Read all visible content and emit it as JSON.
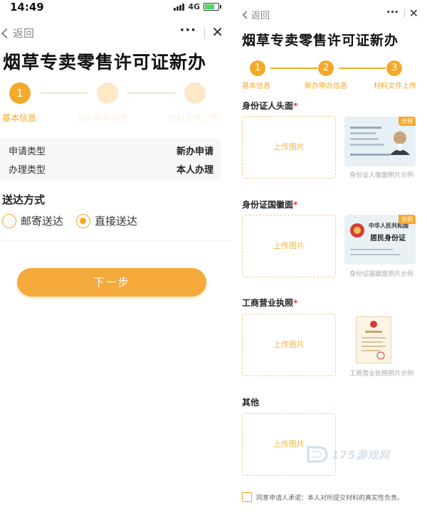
{
  "status": {
    "time": "14:49",
    "network": "4G"
  },
  "left": {
    "nav": {
      "back_label": "返回",
      "more": "···",
      "close": "✕"
    },
    "title": "烟草专卖零售许可证新办",
    "steps": [
      {
        "number": "1",
        "label": "基本信息",
        "active": true
      },
      {
        "number": "2",
        "label": "新办申办信息",
        "active": false
      },
      {
        "number": "3",
        "label": "材料文件上传",
        "active": false
      }
    ],
    "info": [
      {
        "key": "申请类型",
        "value": "新办申请"
      },
      {
        "key": "办理类型",
        "value": "本人办理"
      }
    ],
    "delivery": {
      "title": "送达方式",
      "options": [
        {
          "label": "邮寄送达",
          "checked": false
        },
        {
          "label": "直接送达",
          "checked": true
        }
      ]
    },
    "next_button": "下一步"
  },
  "right": {
    "nav": {
      "back_label": "返回",
      "more": "···",
      "close": "✕"
    },
    "title": "烟草专卖零售许可证新办",
    "steps": [
      {
        "number": "1",
        "label": "基本信息"
      },
      {
        "number": "2",
        "label": "新办申办信息"
      },
      {
        "number": "3",
        "label": "材料文件上传"
      }
    ],
    "sections": [
      {
        "title": "身份证人头面",
        "required": "*",
        "upload": "上传图片",
        "caption": "身份证人像面照片示例",
        "tag": "示例"
      },
      {
        "title": "身份证国徽面",
        "required": "*",
        "upload": "上传图片",
        "caption": "身份证国徽面照片示例",
        "tag": "示例",
        "card_text_1": "中华人民共和国",
        "card_text_2": "居民身份证"
      },
      {
        "title": "工商营业执照",
        "required": "*",
        "upload": "上传图片",
        "caption": "工商营业执照照片示例"
      },
      {
        "title": "其他",
        "required": "",
        "upload": "上传图片"
      }
    ],
    "agreement": "同意申请人承诺：本人对所提交材料的真实性负责。"
  },
  "watermark": "175游戏网",
  "colors": {
    "accent": "#f5a92a",
    "required": "#e83b3b",
    "button": "#f5a93a"
  }
}
